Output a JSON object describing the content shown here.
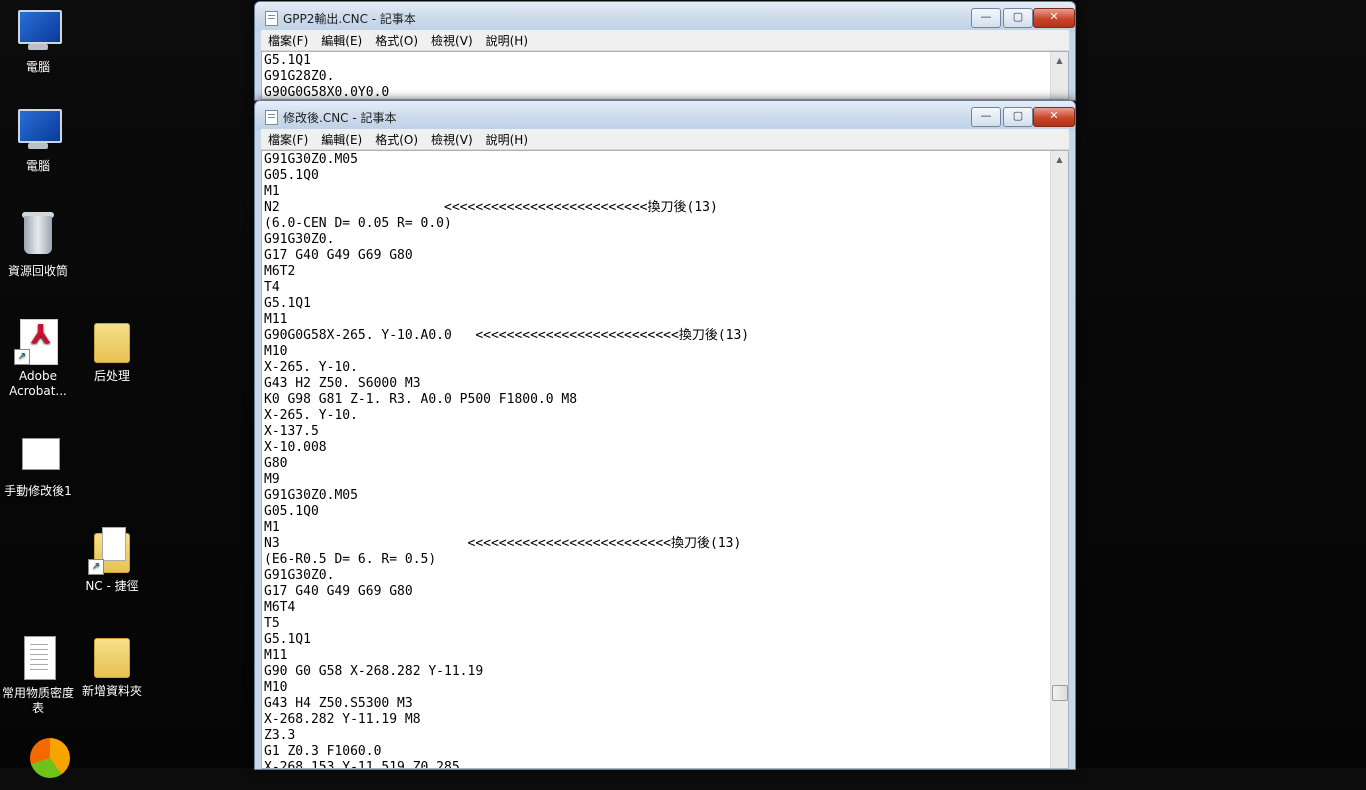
{
  "desktop": {
    "icons": [
      {
        "label": "電腦"
      },
      {
        "label": "電腦"
      },
      {
        "label": "資源回收筒"
      },
      {
        "label": "Adobe Acrobat..."
      },
      {
        "label": "后处理"
      },
      {
        "label": "手動修改後1"
      },
      {
        "label": "NC - 捷徑"
      },
      {
        "label": "常用物质密度表"
      },
      {
        "label": "新增資料夾"
      }
    ]
  },
  "window_back": {
    "title": "GPP2輸出.CNC - 記事本",
    "menu": [
      "檔案(F)",
      "編輯(E)",
      "格式(O)",
      "檢視(V)",
      "說明(H)"
    ],
    "content": "G5.1Q1\nG91G28Z0.\nG90G0G58X0.0Y0.0"
  },
  "window_front": {
    "title": "修改後.CNC - 記事本",
    "menu": [
      "檔案(F)",
      "編輯(E)",
      "格式(O)",
      "檢視(V)",
      "說明(H)"
    ],
    "content": "G91G30Z0.M05\nG05.1Q0\nM1\nN2                     <<<<<<<<<<<<<<<<<<<<<<<<<<換刀後(13)\n(6.0-CEN D= 0.05 R= 0.0)\nG91G30Z0.\nG17 G40 G49 G69 G80\nM6T2\nT4\nG5.1Q1\nM11\nG90G0G58X-265. Y-10.A0.0   <<<<<<<<<<<<<<<<<<<<<<<<<<換刀後(13)\nM10\nX-265. Y-10.\nG43 H2 Z50. S6000 M3\nK0 G98 G81 Z-1. R3. A0.0 P500 F1800.0 M8\nX-265. Y-10.\nX-137.5\nX-10.008\nG80\nM9\nG91G30Z0.M05\nG05.1Q0\nM1\nN3                        <<<<<<<<<<<<<<<<<<<<<<<<<<換刀後(13)\n(E6-R0.5 D= 6. R= 0.5)\nG91G30Z0.\nG17 G40 G49 G69 G80\nM6T4\nT5\nG5.1Q1\nM11\nG90 G0 G58 X-268.282 Y-11.19\nM10\nG43 H4 Z50.S5300 M3\nX-268.282 Y-11.19 M8\nZ3.3\nG1 Z0.3 F1060.0\nX-268.153 Y-11.519 Z0.285"
  },
  "controls": {
    "min": "—",
    "max": "▢",
    "close": "✕"
  },
  "scroll_arrows": {
    "up": "▲"
  }
}
